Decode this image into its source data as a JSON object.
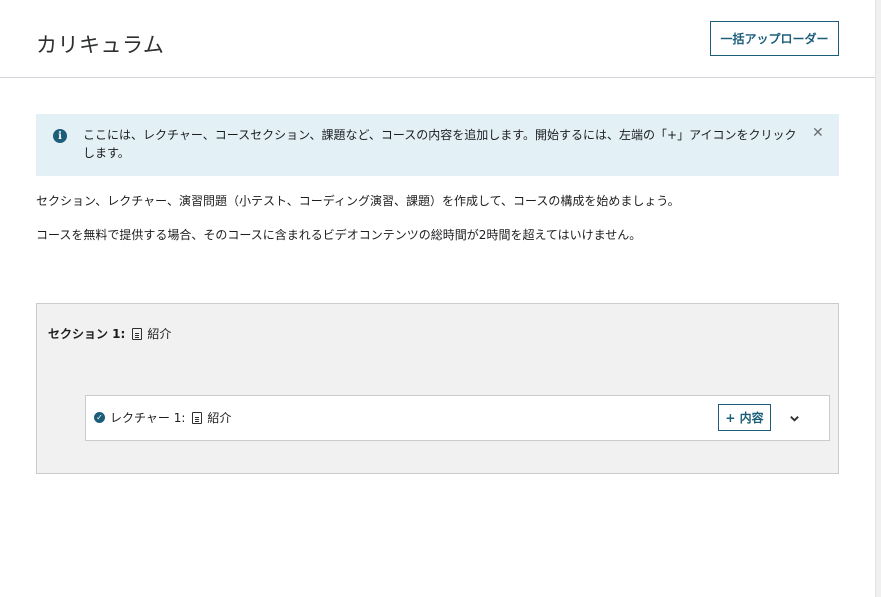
{
  "header": {
    "title": "カリキュラム",
    "bulk_uploader_label": "一括アップローダー"
  },
  "info_banner": {
    "icon": "info-icon",
    "text": "ここには、レクチャー、コースセクション、課題など、コースの内容を追加します。開始するには、左端の「+」アイコンをクリックします。",
    "close_icon": "close-icon"
  },
  "description": {
    "line1": "セクション、レクチャー、演習問題（小テスト、コーディング演習、課題）を作成して、コースの構成を始めましょう。",
    "line2": "コースを無料で提供する場合、そのコースに含まれるビデオコンテンツの総時間が2時間を超えてはいけません。"
  },
  "section": {
    "label": "セクション 1:",
    "title": "紹介",
    "lecture": {
      "label": "レクチャー 1:",
      "title": "紹介",
      "add_content_label": "+ 内容"
    }
  },
  "colors": {
    "accent": "#1c5e7a",
    "banner_bg": "#e3f1f7",
    "section_bg": "#f1f1f1"
  }
}
